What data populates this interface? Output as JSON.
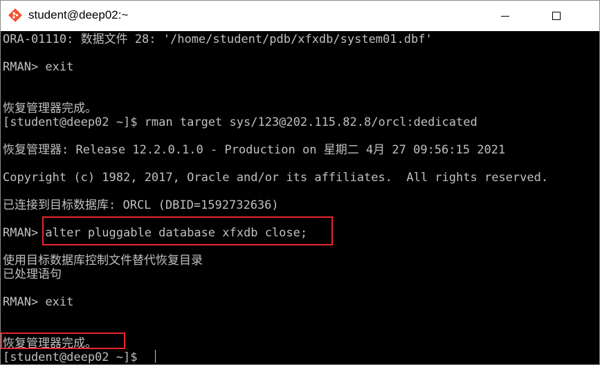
{
  "window": {
    "title": "student@deep02:~",
    "icon": "git-bash-diamond-icon",
    "accent_color": "#e8262a"
  },
  "terminal": {
    "lines": [
      "ORA-01110: 数据文件 28: '/home/student/pdb/xfxdb/system01.dbf'",
      "",
      "RMAN> exit",
      "",
      "",
      "恢复管理器完成。",
      "[student@deep02 ~]$ rman target sys/123@202.115.82.8/orcl:dedicated",
      "",
      "恢复管理器: Release 12.2.0.1.0 - Production on 星期二 4月 27 09:56:15 2021",
      "",
      "Copyright (c) 1982, 2017, Oracle and/or its affiliates.  All rights reserved.",
      "",
      "已连接到目标数据库: ORCL (DBID=1592732636)",
      "",
      "RMAN> alter pluggable database xfxdb close;",
      "",
      "使用目标数据库控制文件替代恢复目录",
      "已处理语句",
      "",
      "RMAN> exit",
      "",
      "",
      "恢复管理器完成。",
      "[student@deep02 ~]$ "
    ],
    "highlighted_command": "alter pluggable database xfxdb close;",
    "highlighted_done": "恢复管理器完成。"
  }
}
